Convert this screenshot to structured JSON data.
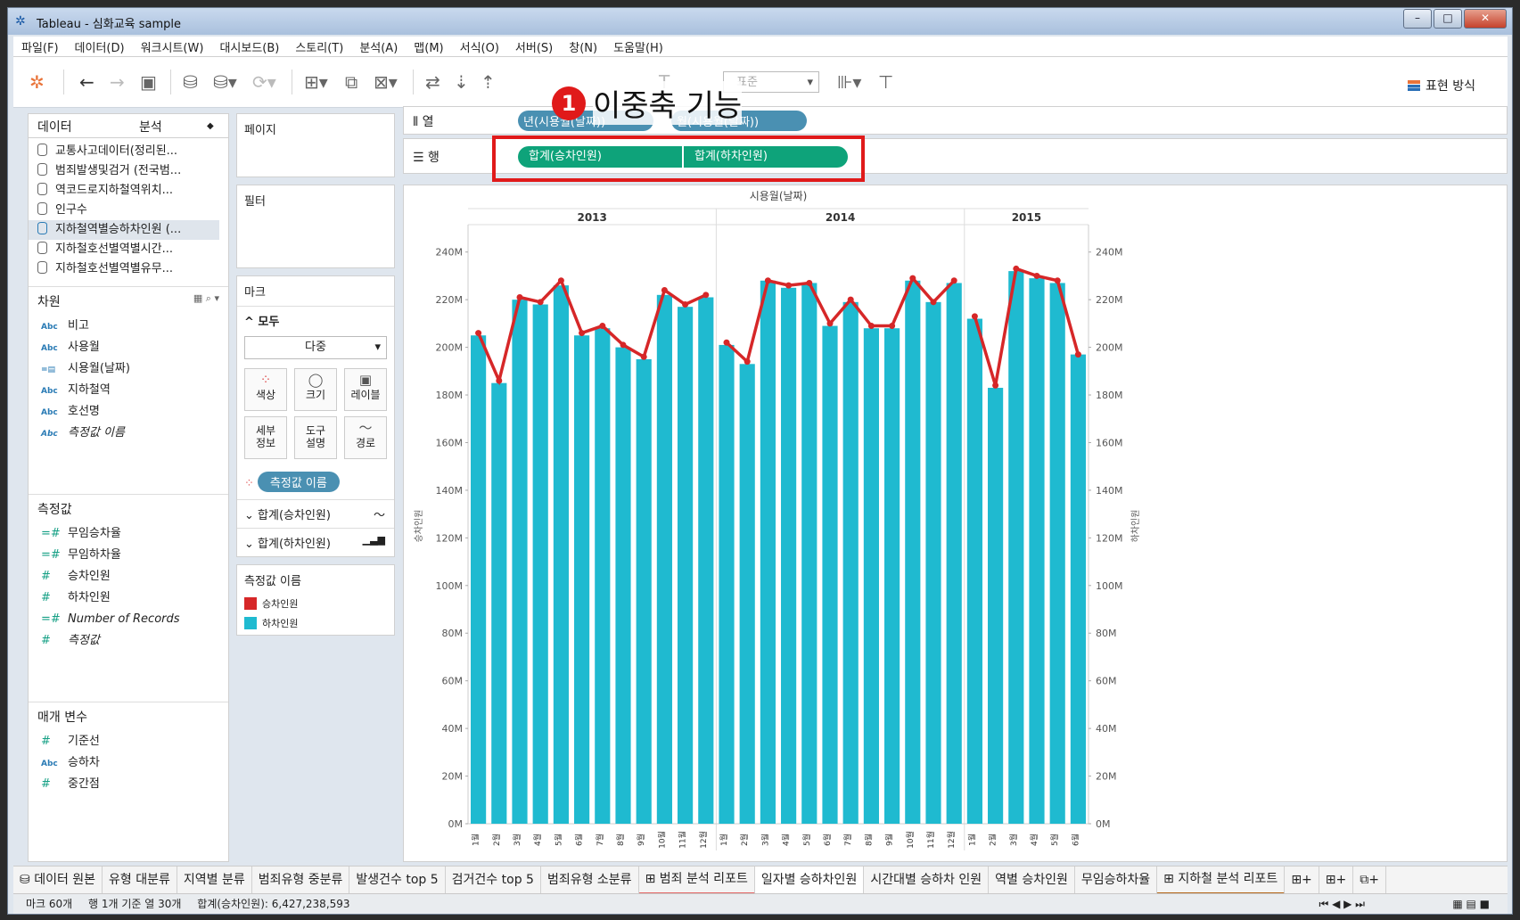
{
  "window": {
    "title": "Tableau - 심화교육 sample"
  },
  "menu": [
    "파일(F)",
    "데이터(D)",
    "워크시트(W)",
    "대시보드(B)",
    "스토리(T)",
    "분석(A)",
    "맵(M)",
    "서식(O)",
    "서버(S)",
    "창(N)",
    "도움말(H)"
  ],
  "toolbar": {
    "show_me": "표현 방식",
    "dropdown_value": "표준"
  },
  "callout": {
    "number": "1",
    "text": "이중축 기능"
  },
  "left_panel": {
    "tabs": [
      "데이터",
      "분석"
    ],
    "datasources": [
      "교통사고데이터(정리된...",
      "범죄발생및검거 (전국범...",
      "역코드로지하철역위치...",
      "인구수",
      "지하철역별승하차인원 (...",
      "지하철호선별역별시간...",
      "지하철호선별역별유무..."
    ],
    "dimensions_title": "차원",
    "dimensions": [
      {
        "type": "Abc",
        "name": "비고"
      },
      {
        "type": "Abc",
        "name": "사용월"
      },
      {
        "type": "date",
        "name": "시용월(날짜)"
      },
      {
        "type": "Abc",
        "name": "지하철역"
      },
      {
        "type": "Abc",
        "name": "호선명"
      },
      {
        "type": "Abc",
        "name": "측정값 이름"
      }
    ],
    "measures_title": "측정값",
    "measures": [
      "무임승차율",
      "무임하차율",
      "승차인원",
      "하차인원",
      "Number of Records",
      "측정값"
    ],
    "params_title": "매개 변수",
    "params": [
      {
        "type": "#",
        "name": "기준선"
      },
      {
        "type": "Abc",
        "name": "승하차"
      },
      {
        "type": "#",
        "name": "중간점"
      }
    ]
  },
  "pages_title": "페이지",
  "filters_title": "필터",
  "marks": {
    "title": "마크",
    "all": "모두",
    "type": "다중",
    "buttons": [
      "색상",
      "크기",
      "레이블",
      "세부\n정보",
      "도구\n설명",
      "경로"
    ],
    "color_pill": "측정값 이름",
    "cards": [
      "합계(승차인원)",
      "합계(하차인원)"
    ]
  },
  "legend": {
    "title": "측정값 이름",
    "items": [
      {
        "label": "승차인원",
        "color": "#d62728"
      },
      {
        "label": "하차인원",
        "color": "#1fbad0"
      }
    ]
  },
  "shelves": {
    "columns_label": "열",
    "rows_label": "행",
    "columns_pills": [
      "년(시용월(날짜))",
      "월(시용월(날짜))"
    ],
    "rows_pills": [
      "합계(승차인원)",
      "합계(하차인원)"
    ]
  },
  "chart_data": {
    "type": "bar",
    "title": "시용월(날짜)",
    "ylabel_left": "승차인원",
    "ylabel_right": "하차인원",
    "ylim": [
      0,
      250
    ],
    "y_ticks": [
      "0M",
      "20M",
      "40M",
      "60M",
      "80M",
      "100M",
      "120M",
      "140M",
      "160M",
      "180M",
      "200M",
      "220M",
      "240M"
    ],
    "years": [
      {
        "year": "2013",
        "months": [
          "1월",
          "2월",
          "3월",
          "4월",
          "5월",
          "6월",
          "7월",
          "8월",
          "9월",
          "10월",
          "11월",
          "12월"
        ]
      },
      {
        "year": "2014",
        "months": [
          "1월",
          "2월",
          "3월",
          "4월",
          "5월",
          "6월",
          "7월",
          "8월",
          "9월",
          "10월",
          "11월",
          "12월"
        ]
      },
      {
        "year": "2015",
        "months": [
          "1월",
          "2월",
          "3월",
          "4월",
          "5월",
          "6월"
        ]
      }
    ],
    "series": [
      {
        "name": "하차인원",
        "mark": "bar",
        "color": "#1fbad0",
        "values": [
          205,
          185,
          220,
          218,
          226,
          205,
          208,
          200,
          195,
          222,
          217,
          221,
          201,
          193,
          228,
          225,
          227,
          209,
          219,
          208,
          208,
          228,
          219,
          227,
          212,
          183,
          232,
          229,
          227,
          197
        ]
      },
      {
        "name": "승차인원",
        "mark": "line",
        "color": "#d62728",
        "values": [
          206,
          186,
          221,
          219,
          228,
          206,
          209,
          201,
          196,
          224,
          218,
          222,
          202,
          194,
          228,
          226,
          227,
          210,
          220,
          209,
          209,
          229,
          219,
          228,
          213,
          184,
          233,
          230,
          228,
          197
        ]
      }
    ]
  },
  "sheet_tabs": [
    "데이터 원본",
    "유형 대분류",
    "지역별 분류",
    "범죄유형 중분류",
    "발생건수 top 5",
    "검거건수 top 5",
    "범죄유형 소분류",
    "범죄 분석 리포트",
    "일자별 승하차인원",
    "시간대별 승하차 인원",
    "역별 승차인원",
    "무임승하차율",
    "지하철 분석 리포트"
  ],
  "status": {
    "marks": "마크 60개",
    "rows": "행 1개 기준 열 30개",
    "sum": "합계(승차인원): 6,427,238,593"
  }
}
